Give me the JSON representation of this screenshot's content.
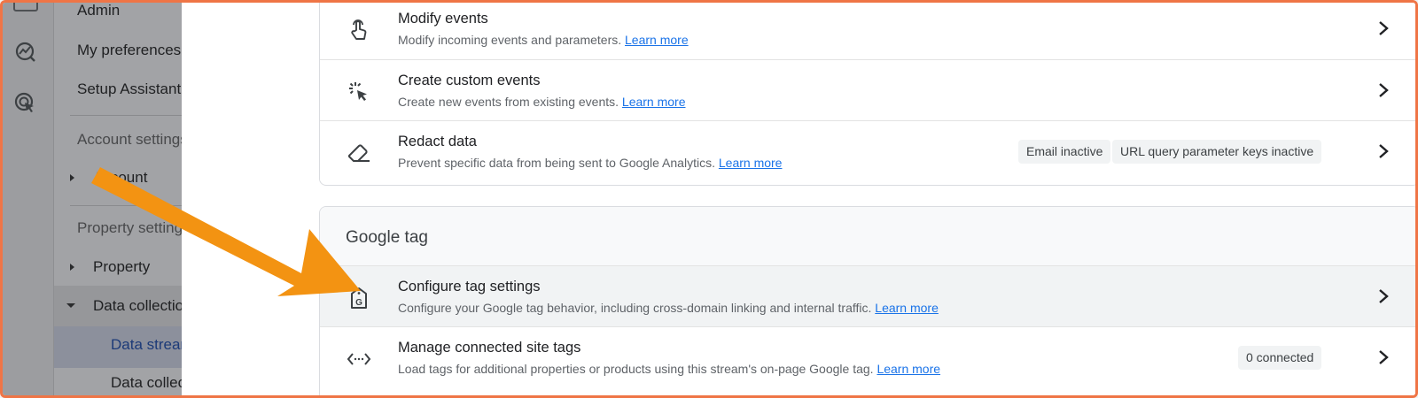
{
  "sidebar": {
    "items": [
      {
        "label": "Admin"
      },
      {
        "label": "My preferences"
      },
      {
        "label": "Setup Assistant"
      }
    ],
    "account_section": "Account settings",
    "account_item": "Account",
    "property_section": "Property settings",
    "property_item": "Property",
    "data_collection_item": "Data collection",
    "data_streams_item": "Data streams",
    "data_collection_sub": "Data collection"
  },
  "events_card": {
    "rows": [
      {
        "title": "Modify events",
        "desc": "Modify incoming events and parameters.",
        "link": "Learn more"
      },
      {
        "title": "Create custom events",
        "desc": "Create new events from existing events.",
        "link": "Learn more"
      },
      {
        "title": "Redact data",
        "desc": "Prevent specific data from being sent to Google Analytics.",
        "link": "Learn more",
        "chips": [
          "Email inactive",
          "URL query parameter keys inactive"
        ]
      }
    ]
  },
  "google_tag_card": {
    "heading": "Google tag",
    "rows": [
      {
        "title": "Configure tag settings",
        "desc": "Configure your Google tag behavior, including cross-domain linking and internal traffic.",
        "link": "Learn more"
      },
      {
        "title": "Manage connected site tags",
        "desc": "Load tags for additional properties or products using this stream's on-page Google tag.",
        "link": "Learn more",
        "chip": "0 connected"
      }
    ]
  },
  "icons": [
    "touch-icon",
    "sparkle-cursor-icon",
    "eraser-icon",
    "google-tag-icon",
    "code-arrows-icon",
    "chevron-right-icon",
    "insights-icon",
    "ads-cursor-icon"
  ],
  "colors": {
    "accent": "#1a73e8",
    "annotation_arrow": "#f39312",
    "frame_border": "#ef7546"
  }
}
